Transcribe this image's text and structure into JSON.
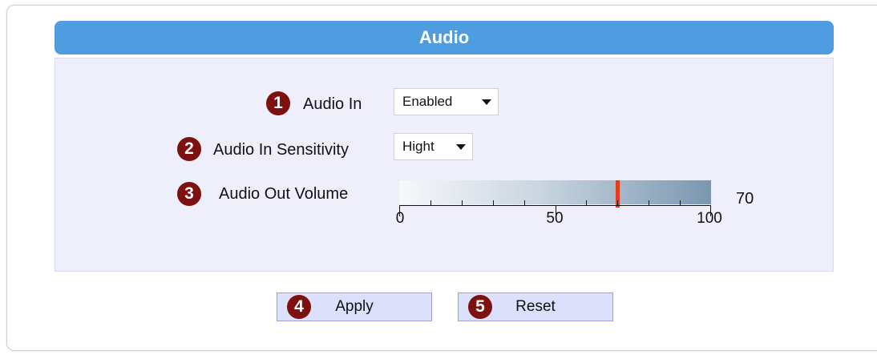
{
  "section": {
    "title": "Audio"
  },
  "fields": {
    "audio_in": {
      "number": "1",
      "label": "Audio In",
      "value": "Enabled"
    },
    "audio_in_sensitivity": {
      "number": "2",
      "label": "Audio In Sensitivity",
      "value": "Hight"
    },
    "audio_out_volume": {
      "number": "3",
      "label": "Audio Out Volume",
      "value": "70",
      "min": 0,
      "max": 100,
      "level": 70,
      "scale_labels": [
        "0",
        "50",
        "100"
      ],
      "thumb_color": "#e83a1c"
    }
  },
  "buttons": {
    "apply": {
      "number": "4",
      "label": "Apply"
    },
    "reset": {
      "number": "5",
      "label": "Reset"
    }
  },
  "colors": {
    "title_bar": "#4f9de0",
    "badge": "#7d1110",
    "panel": "#eeeffb"
  },
  "icons": {
    "select_arrow": "chevron-down-icon"
  }
}
